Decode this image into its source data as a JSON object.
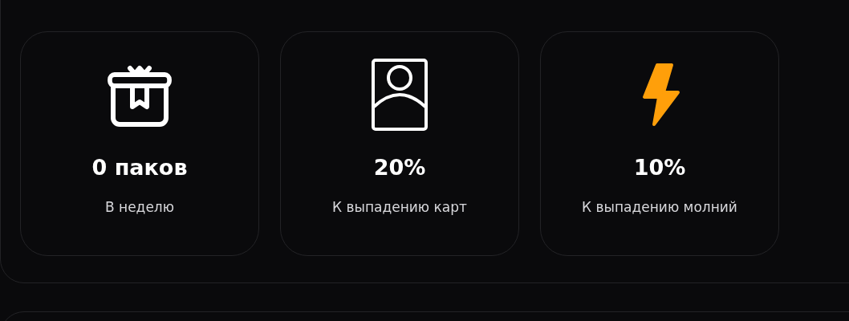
{
  "bonuses": [
    {
      "value": "0 паков",
      "label": "В неделю"
    },
    {
      "value": "20%",
      "label": "К выпадению карт"
    },
    {
      "value": "10%",
      "label": "К выпадению молний"
    }
  ]
}
